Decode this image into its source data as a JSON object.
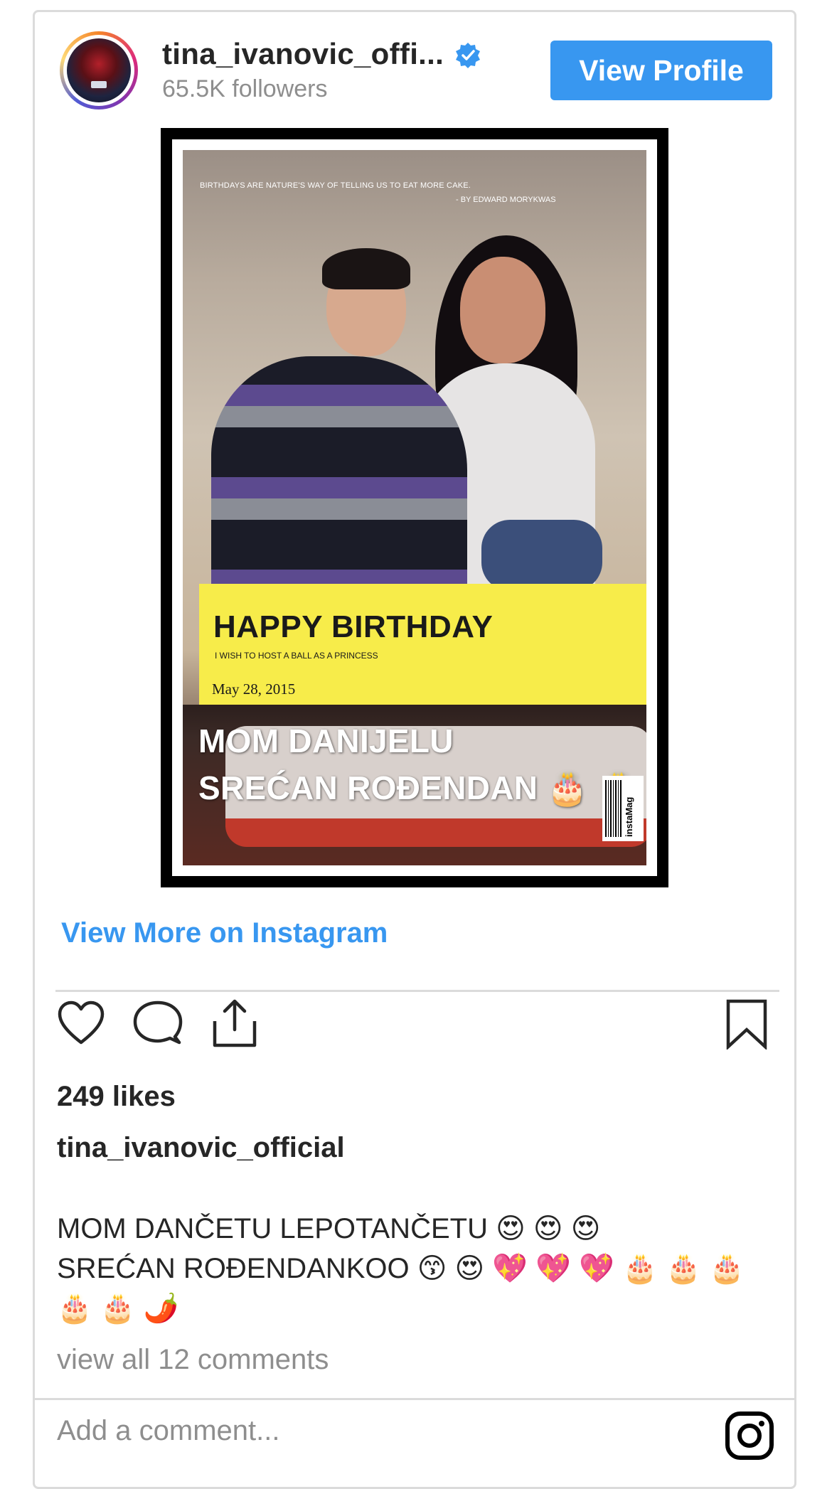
{
  "header": {
    "username": "tina_ivanovic_offi...",
    "followers": "65.5K followers",
    "view_profile_label": "View Profile"
  },
  "post_image": {
    "quote": "BIRTHDAYS ARE NATURE'S WAY OF TELLING US TO EAT MORE CAKE.",
    "quote_author": "- BY EDWARD MORYKWAS",
    "banner_title": "HAPPY BIRTHDAY",
    "banner_subtitle": "I WISH TO HOST A BALL AS A PRINCESS",
    "banner_date": "May 28, 2015",
    "caption_line1": "MOM DANIJELU",
    "caption_line2": "SREĆAN ROĐENDAN 🎂 🎂",
    "barcode_brand": "instaMag"
  },
  "links": {
    "view_more": "View More on Instagram"
  },
  "actions": {
    "like_icon": "heart-icon",
    "comment_icon": "comment-icon",
    "share_icon": "share-icon",
    "save_icon": "bookmark-icon"
  },
  "stats": {
    "likes": "249 likes"
  },
  "caption": {
    "username": "tina_ivanovic_official",
    "text": "MOM DANČETU LEPOTANČETU 😍 😍 😍\nSREĆAN ROĐENDANKOO 😙 😍 💖 💖 💖 🎂 🎂 🎂\n🎂 🎂 🌶️"
  },
  "comments": {
    "view_all": "view all 12 comments"
  },
  "comment_input": {
    "placeholder": "Add a comment..."
  },
  "colors": {
    "accent": "#3897f0",
    "border": "#dbdbdb",
    "muted": "#8e8e8e",
    "banner_yellow": "#f7ec4a"
  }
}
